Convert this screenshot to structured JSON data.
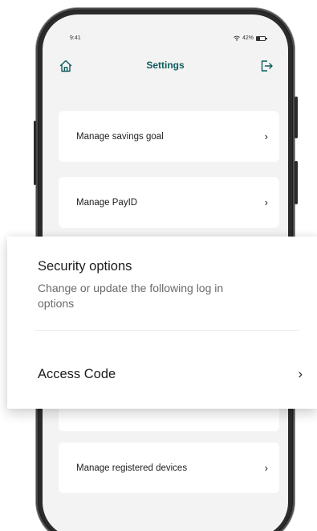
{
  "status_bar": {
    "time": "9:41",
    "battery": "42%"
  },
  "header": {
    "title": "Settings",
    "left_icon": "home-icon",
    "right_icon": "logout-icon"
  },
  "settings_items": [
    {
      "label": "Manage savings goal"
    },
    {
      "label": "Manage PayID"
    },
    {
      "label": "Manage registered devices"
    }
  ],
  "security_panel": {
    "title": "Security options",
    "subtitle": "Change or update the following log in options",
    "options": [
      {
        "label": "Access Code"
      }
    ]
  },
  "colors": {
    "title": "#0e5c5c",
    "screen_bg": "#f3f3f3",
    "card_bg": "#ffffff"
  }
}
